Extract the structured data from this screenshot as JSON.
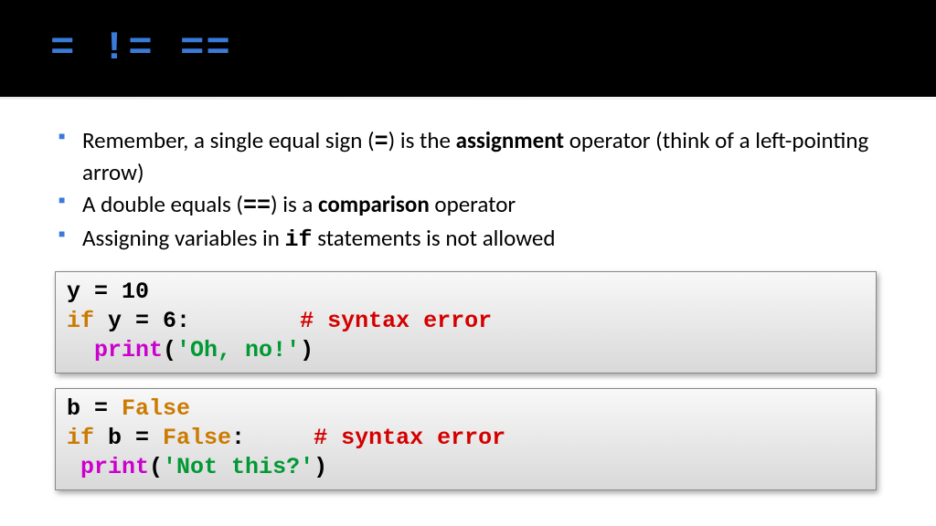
{
  "header": {
    "title": "= != =="
  },
  "bullets": {
    "b1_a": "Remember, a single equal sign (",
    "b1_eq": "=",
    "b1_b": ") is the ",
    "b1_assign": "assignment",
    "b1_c": " operator (think of a left-pointing arrow)",
    "b2_a": "A double equals (",
    "b2_eq": "==",
    "b2_b": ") is a ",
    "b2_comp": "comparison",
    "b2_c": " operator",
    "b3_a": "Assigning variables in ",
    "b3_if": "if",
    "b3_b": " statements is not allowed"
  },
  "code1": {
    "l1": "y = 10",
    "l2_kw": "if",
    "l2_mid": " y = 6:        ",
    "l2_err": "# syntax error",
    "l3_pad": "  ",
    "l3_fn": "print",
    "l3_paren1": "(",
    "l3_str": "'Oh, no!'",
    "l3_paren2": ")"
  },
  "code2": {
    "l1_a": "b = ",
    "l1_false": "False",
    "l2_kw": "if",
    "l2_a": " b = ",
    "l2_false": "False",
    "l2_b": ":     ",
    "l2_err": "# syntax error",
    "l3_pad": " ",
    "l3_fn": "print",
    "l3_paren1": "(",
    "l3_str": "'Not this?'",
    "l3_paren2": ")"
  }
}
